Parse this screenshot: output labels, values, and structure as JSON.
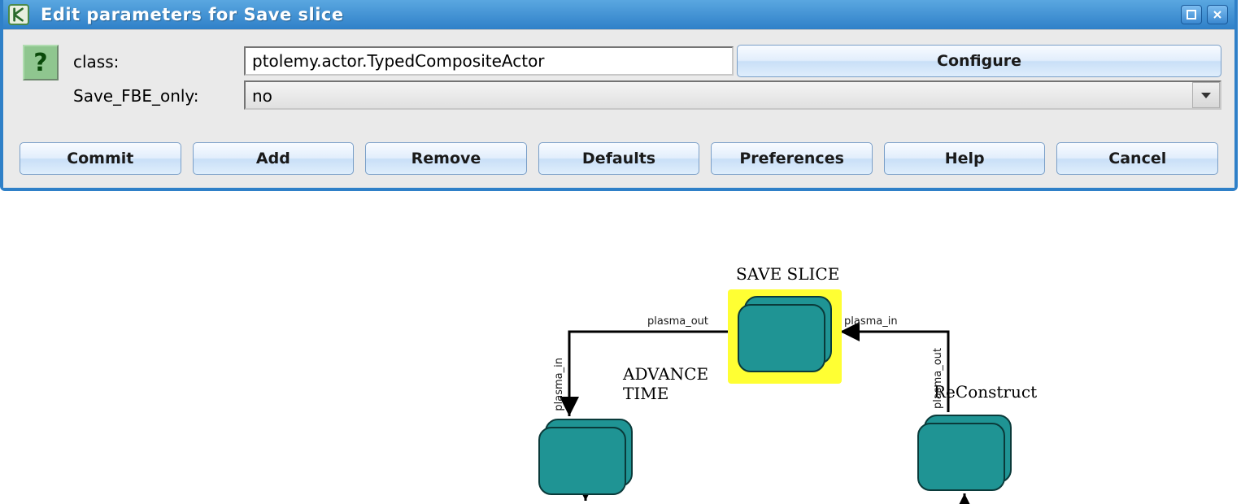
{
  "window": {
    "title": "Edit parameters for Save slice"
  },
  "form": {
    "class_label": "class:",
    "class_value": "ptolemy.actor.TypedCompositeActor",
    "save_fbe_label": "Save_FBE_only:",
    "save_fbe_value": "no",
    "configure_label": "Configure"
  },
  "buttons": {
    "commit": "Commit",
    "add": "Add",
    "remove": "Remove",
    "defaults": "Defaults",
    "preferences": "Preferences",
    "help": "Help",
    "cancel": "Cancel"
  },
  "diagram": {
    "save_slice_label": "SAVE SLICE",
    "advance_time_label": "ADVANCE\nTIME",
    "reconstruct_label": "ReConstruct",
    "port_plasma_out": "plasma_out",
    "port_plasma_in": "plasma_in",
    "port_plasma_in_v": "plasma_in",
    "port_plasma_out_v": "plasma_out"
  }
}
